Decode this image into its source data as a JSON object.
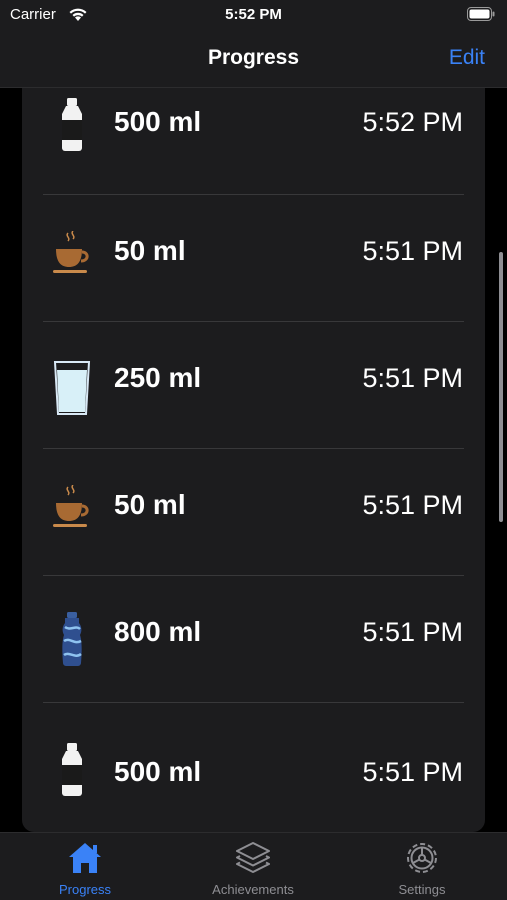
{
  "status_bar": {
    "carrier": "Carrier",
    "time": "5:52 PM"
  },
  "nav": {
    "title": "Progress",
    "edit_label": "Edit"
  },
  "entries": [
    {
      "amount": "500 ml",
      "time": "5:52 PM",
      "icon": "water-bottle-icon"
    },
    {
      "amount": "50 ml",
      "time": "5:51 PM",
      "icon": "coffee-cup-icon"
    },
    {
      "amount": "250 ml",
      "time": "5:51 PM",
      "icon": "water-glass-icon"
    },
    {
      "amount": "50 ml",
      "time": "5:51 PM",
      "icon": "coffee-cup-icon"
    },
    {
      "amount": "800 ml",
      "time": "5:51 PM",
      "icon": "sports-bottle-icon"
    },
    {
      "amount": "500 ml",
      "time": "5:51 PM",
      "icon": "water-bottle-icon"
    }
  ],
  "tabs": [
    {
      "label": "Progress",
      "icon": "house-icon",
      "active": true
    },
    {
      "label": "Achievements",
      "icon": "stack-icon",
      "active": false
    },
    {
      "label": "Settings",
      "icon": "gear-icon",
      "active": false
    }
  ],
  "colors": {
    "accent": "#3a82f7",
    "background": "#000000",
    "surface": "#1c1c1e",
    "inactive": "#8e8e93"
  }
}
